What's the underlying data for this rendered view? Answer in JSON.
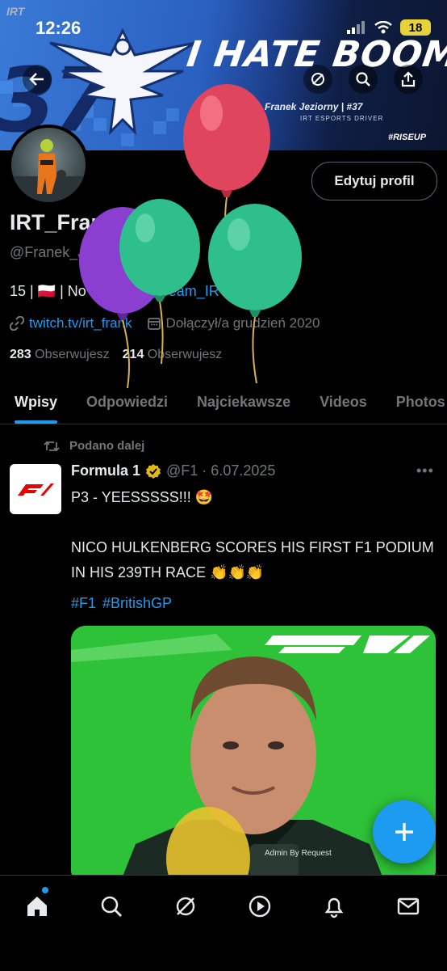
{
  "status_bar": {
    "time": "12:26",
    "battery": "18"
  },
  "banner": {
    "irt": "IRT",
    "number": "37",
    "headline": "I HATE BOOMPJE",
    "driver_name": "Franek Jeziorny | #37",
    "driver_role": "IRT ESPORTS DRIVER",
    "tag": "#RISEUP"
  },
  "profile": {
    "display_name": "IRT_Frank",
    "handle": "@Franek_Jeziorny",
    "edit_label": "Edytuj profil",
    "bio_prefix": "15 | 🇵🇱 | No assists | ",
    "bio_mention": "@Team_IRT",
    "link": "twitch.tv/irt_frank",
    "joined": "Dołączył/a grudzień 2020",
    "following_count": "283",
    "following_label": "Obserwujesz",
    "followers_count": "214",
    "followers_label": "Obserwujesz"
  },
  "tabs": [
    "Wpisy",
    "Odpowiedzi",
    "Najciekawsze",
    "Videos",
    "Photos"
  ],
  "post": {
    "repost_label": "Podano dalej",
    "author": "Formula 1",
    "meta": "@F1 · 6.07.2025",
    "text": "P3 - YEESSSSS!!! 🤩\n\nNICO HULKENBERG SCORES HIS FIRST F1 PODIUM IN HIS 239TH RACE 👏👏👏",
    "hashtags": [
      "#F1",
      "#BritishGP"
    ],
    "media_badge": "Admin By Request"
  },
  "colors": {
    "accent": "#1d9bf0",
    "balloon_red": "#e0455e",
    "balloon_green": "#2fbf8d",
    "balloon_purple": "#8a3fd0",
    "media_bg": "#2ec238"
  },
  "icons": [
    "back-icon",
    "view-icon",
    "search-icon",
    "share-icon",
    "retweet-icon",
    "link-icon",
    "calendar-icon",
    "verified-icon",
    "plus-icon",
    "home-icon",
    "explore-icon",
    "grok-icon",
    "video-icon",
    "bell-icon",
    "mail-icon"
  ]
}
